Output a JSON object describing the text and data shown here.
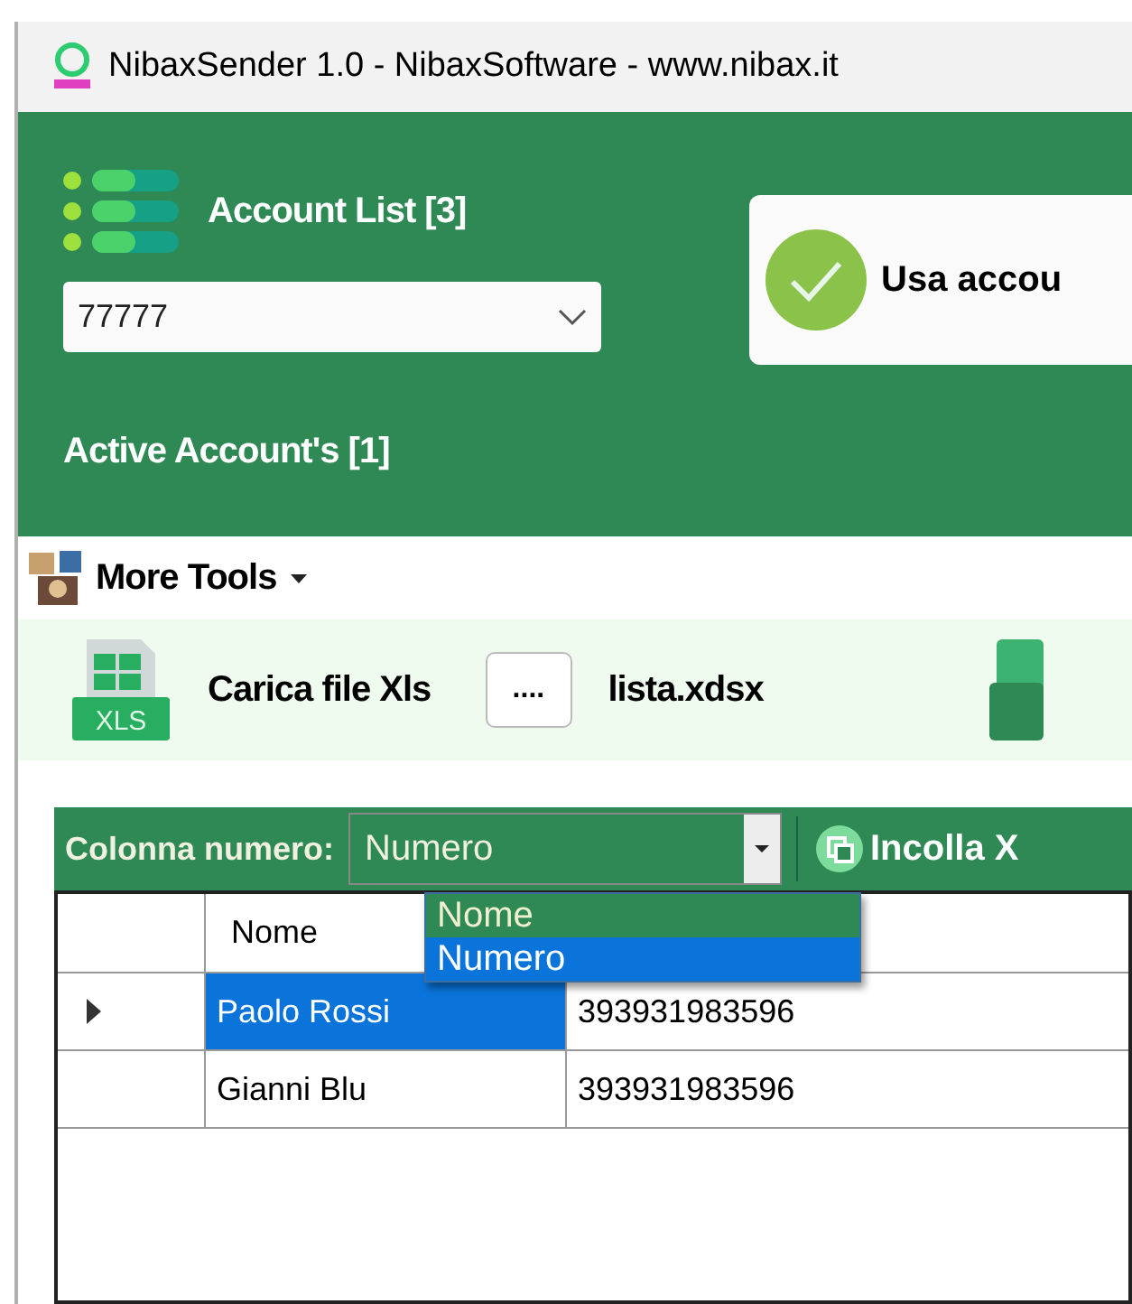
{
  "window": {
    "title": "NibaxSender 1.0 - NibaxSoftware - www.nibax.it"
  },
  "accounts": {
    "title": "Account List [3]",
    "combo_value": "77777",
    "active": "Active Account's [1]"
  },
  "use_account_card": {
    "label": "Usa accou"
  },
  "more_tools": {
    "label": "More Tools"
  },
  "file_strip": {
    "load_label": "Carica file Xls",
    "xls_icon_text": "XLS",
    "browse_button": "....",
    "file_name": "lista.xdsx"
  },
  "grid_toolbar": {
    "label": "Colonna numero:",
    "combo_value": "Numero",
    "paste_button": "Incolla X"
  },
  "dropdown": [
    {
      "label": "Nome",
      "selected": false
    },
    {
      "label": "Numero",
      "selected": true
    }
  ],
  "table": {
    "columns": [
      "Nome"
    ],
    "rows": [
      {
        "cells": [
          "Paolo Rossi",
          "393931983596"
        ],
        "selected": true
      },
      {
        "cells": [
          "Gianni Blu",
          "393931983596"
        ],
        "selected": false
      }
    ]
  }
}
